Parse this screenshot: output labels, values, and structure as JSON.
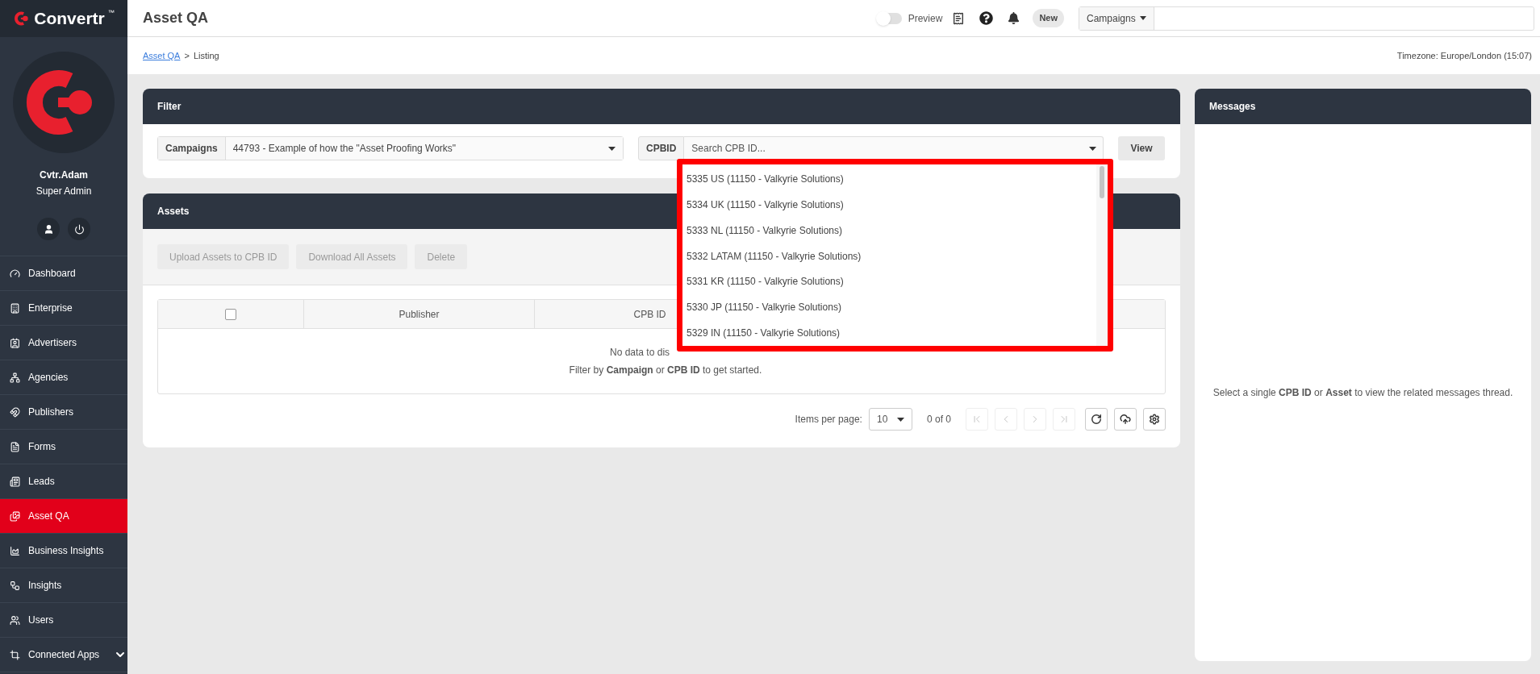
{
  "brand": {
    "name": "Convertr",
    "mark": "™"
  },
  "header": {
    "title": "Asset QA",
    "preview": {
      "label": "Preview",
      "on": false
    },
    "new_badge": "New",
    "search": {
      "scope": "Campaigns"
    }
  },
  "breadcrumb": {
    "link": "Asset QA",
    "separator": ">",
    "current": "Listing"
  },
  "timezone": "Timezone: Europe/London (15:07)",
  "user": {
    "name": "Cvtr.Adam",
    "role": "Super Admin"
  },
  "sidebar": {
    "items": [
      {
        "label": "Dashboard",
        "kind": "dashboard",
        "selected": false
      },
      {
        "label": "Enterprise",
        "kind": "enterprise",
        "selected": false
      },
      {
        "label": "Advertisers",
        "kind": "advertisers",
        "selected": false
      },
      {
        "label": "Agencies",
        "kind": "agencies",
        "selected": false
      },
      {
        "label": "Publishers",
        "kind": "publishers",
        "selected": false
      },
      {
        "label": "Forms",
        "kind": "forms",
        "selected": false
      },
      {
        "label": "Leads",
        "kind": "leads",
        "selected": false
      },
      {
        "label": "Asset QA",
        "kind": "assets",
        "selected": true
      },
      {
        "label": "Business Insights",
        "kind": "business",
        "selected": false
      },
      {
        "label": "Insights",
        "kind": "insights",
        "selected": false
      },
      {
        "label": "Users",
        "kind": "users",
        "selected": false
      },
      {
        "label": "Connected Apps",
        "kind": "apps",
        "selected": false,
        "expandable": true
      }
    ]
  },
  "filter": {
    "title": "Filter",
    "campaign": {
      "label": "Campaigns",
      "value": "44793 - Example of how the \"Asset Proofing Works\""
    },
    "cpbid": {
      "label": "CPBID",
      "placeholder": "Search CPB ID...",
      "expanded": true,
      "highlighted": true,
      "options": [
        "5335 US (11150 - Valkyrie Solutions)",
        "5334 UK (11150 - Valkyrie Solutions)",
        "5333 NL (11150 - Valkyrie Solutions)",
        "5332 LATAM (11150 - Valkyrie Solutions)",
        "5331 KR (11150 - Valkyrie Solutions)",
        "5330 JP (11150 - Valkyrie Solutions)",
        "5329 IN (11150 - Valkyrie Solutions)"
      ]
    },
    "view_button": "View"
  },
  "assets": {
    "title": "Assets",
    "actions": [
      {
        "label": "Upload Assets to CPB ID",
        "disabled": true
      },
      {
        "label": "Download All Assets",
        "disabled": true
      },
      {
        "label": "Delete",
        "disabled": true
      }
    ],
    "table": {
      "select_all": {
        "checked": false
      },
      "columns": [
        "Publisher",
        "CPB ID"
      ],
      "empty_message": "No data to dis",
      "hint": "Filter by **Campaign** or **CPB ID** to get started."
    },
    "pagination": {
      "items_label": "Items per page:",
      "page_size": "10",
      "range": "0 of 0",
      "buttons": [
        {
          "kind": "first",
          "disabled": true
        },
        {
          "kind": "previous",
          "disabled": true
        },
        {
          "kind": "next",
          "disabled": true
        },
        {
          "kind": "last",
          "disabled": true
        },
        {
          "kind": "refresh",
          "disabled": false
        },
        {
          "kind": "upload",
          "disabled": false
        },
        {
          "kind": "settings",
          "disabled": false
        }
      ]
    }
  },
  "messages": {
    "title": "Messages",
    "hint": "Select a single **CPB ID** or **Asset** to view the related messages thread."
  }
}
